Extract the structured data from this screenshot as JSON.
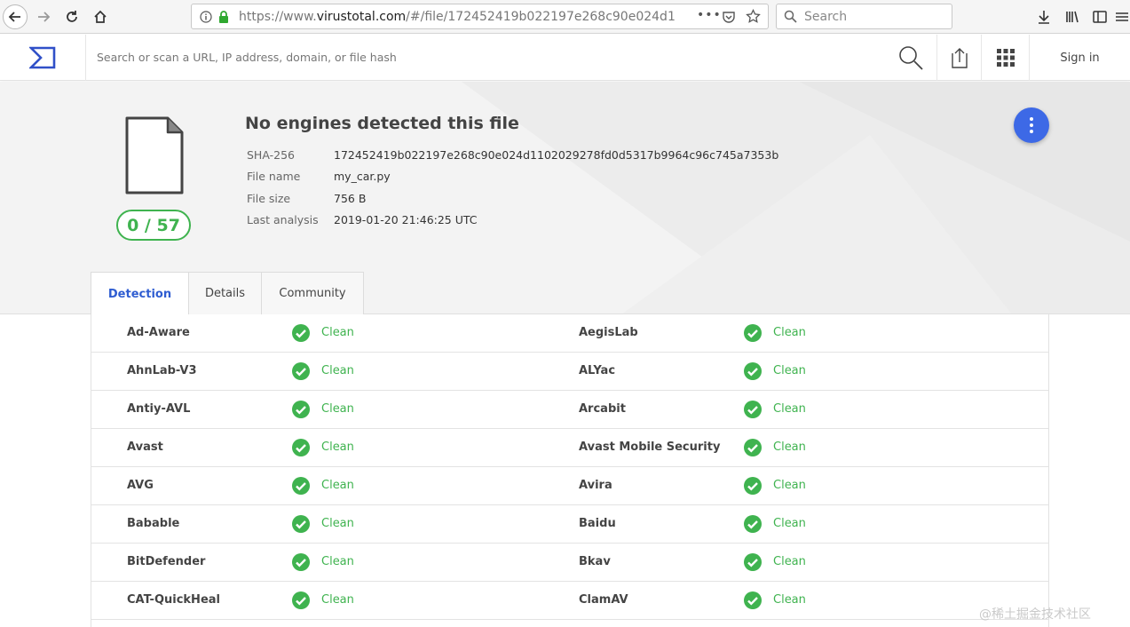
{
  "browser": {
    "url_prefix": "https://www.",
    "url_host": "virustotal.com",
    "url_rest": "/#/file/172452419b022197e268c90e024d1",
    "search_placeholder": "Search"
  },
  "header": {
    "search_placeholder": "Search or scan a URL, IP address, domain, or file hash",
    "sign_in": "Sign in"
  },
  "summary": {
    "title": "No engines detected this file",
    "score": "0 / 57",
    "fields": [
      {
        "label": "SHA-256",
        "value": "172452419b022197e268c90e024d1102029278fd0d5317b9964c96c745a7353b"
      },
      {
        "label": "File name",
        "value": "my_car.py"
      },
      {
        "label": "File size",
        "value": "756 B"
      },
      {
        "label": "Last analysis",
        "value": "2019-01-20 21:46:25 UTC"
      }
    ]
  },
  "tabs": [
    "Detection",
    "Details",
    "Community"
  ],
  "results": [
    {
      "left": {
        "engine": "Ad-Aware",
        "status": "Clean"
      },
      "right": {
        "engine": "AegisLab",
        "status": "Clean"
      }
    },
    {
      "left": {
        "engine": "AhnLab-V3",
        "status": "Clean"
      },
      "right": {
        "engine": "ALYac",
        "status": "Clean"
      }
    },
    {
      "left": {
        "engine": "Antiy-AVL",
        "status": "Clean"
      },
      "right": {
        "engine": "Arcabit",
        "status": "Clean"
      }
    },
    {
      "left": {
        "engine": "Avast",
        "status": "Clean"
      },
      "right": {
        "engine": "Avast Mobile Security",
        "status": "Clean"
      }
    },
    {
      "left": {
        "engine": "AVG",
        "status": "Clean"
      },
      "right": {
        "engine": "Avira",
        "status": "Clean"
      }
    },
    {
      "left": {
        "engine": "Babable",
        "status": "Clean"
      },
      "right": {
        "engine": "Baidu",
        "status": "Clean"
      }
    },
    {
      "left": {
        "engine": "BitDefender",
        "status": "Clean"
      },
      "right": {
        "engine": "Bkav",
        "status": "Clean"
      }
    },
    {
      "left": {
        "engine": "CAT-QuickHeal",
        "status": "Clean"
      },
      "right": {
        "engine": "ClamAV",
        "status": "Clean"
      }
    }
  ],
  "watermark": "@稀土掘金技术社区",
  "colors": {
    "clean": "#3fb34f",
    "accent": "#3d69e6",
    "logo": "#3050c8"
  }
}
